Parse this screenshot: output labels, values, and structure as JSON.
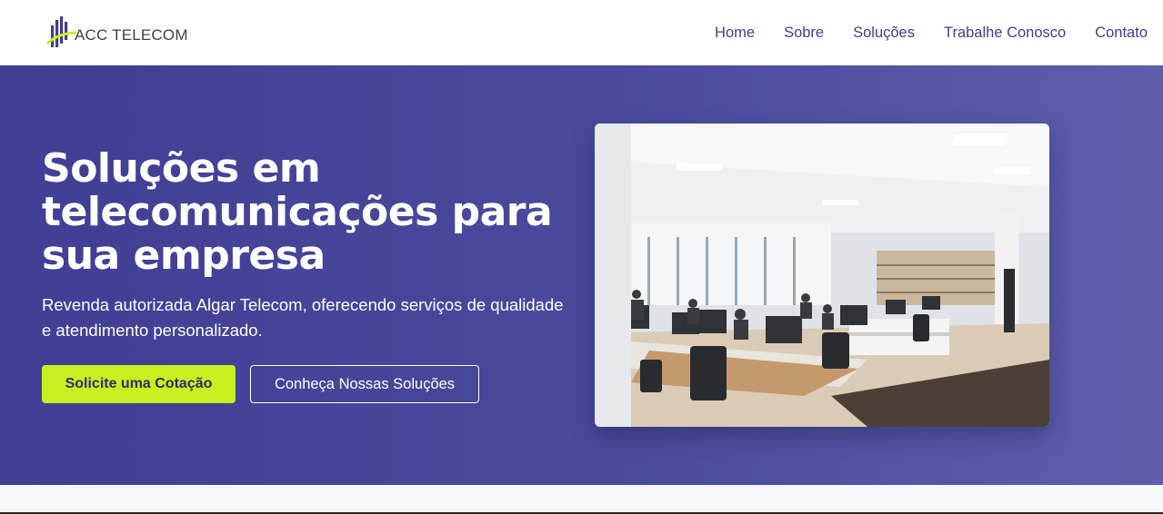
{
  "brand": {
    "name": "ACC TELECOM",
    "logo_icon": "acc-telecom-logo-icon",
    "colors": {
      "navy": "#403e95",
      "accent": "#c8f01e",
      "nav_text": "#3d3f8c"
    }
  },
  "nav": {
    "items": [
      {
        "label": "Home"
      },
      {
        "label": "Sobre"
      },
      {
        "label": "Soluções"
      },
      {
        "label": "Trabalhe Conosco"
      },
      {
        "label": "Contato"
      }
    ]
  },
  "hero": {
    "title_lines": [
      "Soluções em",
      "telecomunicações para",
      "sua empresa"
    ],
    "subtitle_lines": [
      "Revenda autorizada Algar Telecom, oferecendo serviços de qualidade",
      "e atendimento personalizado."
    ],
    "primary_button": "Solicite uma Cotação",
    "secondary_button": "Conheça Nossas Soluções",
    "image_icon": "office-photo"
  }
}
